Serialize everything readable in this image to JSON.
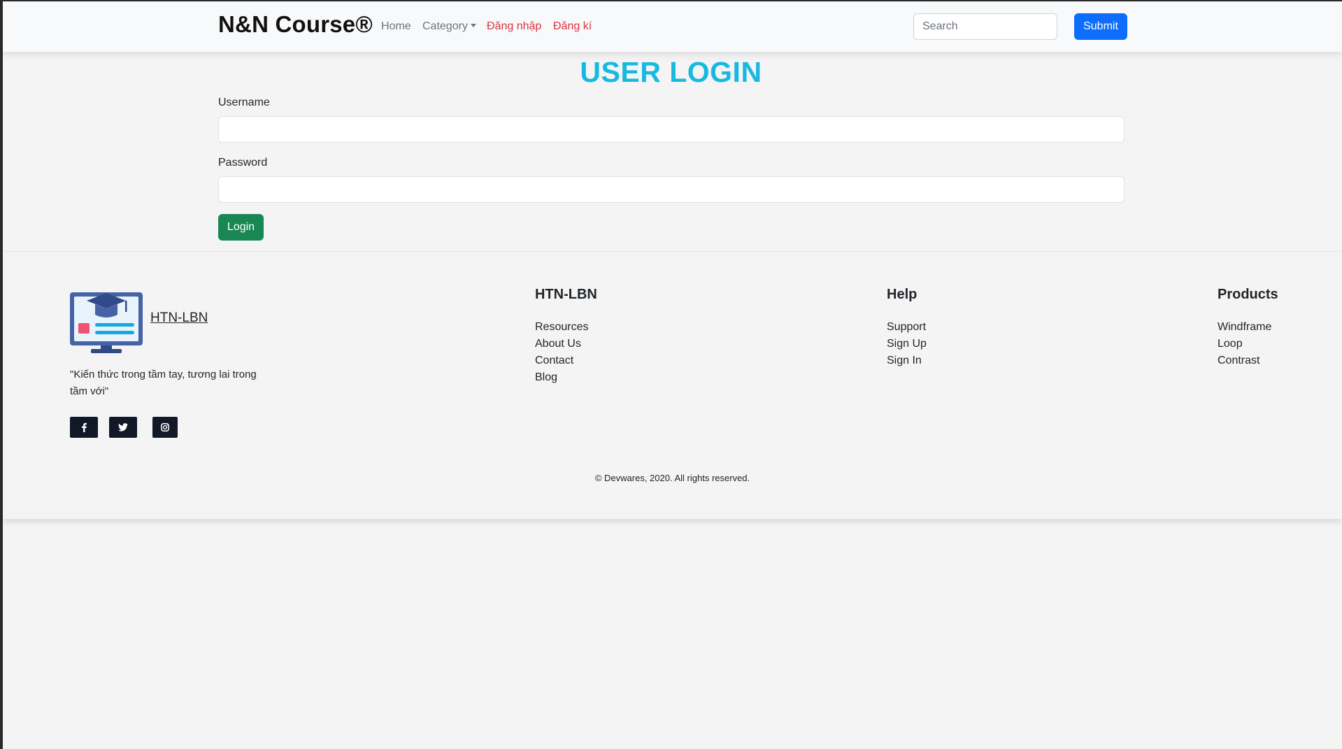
{
  "navbar": {
    "brand": "N&N Course®",
    "links": [
      {
        "label": "Home"
      },
      {
        "label": "Category"
      },
      {
        "label": "Đăng nhập"
      },
      {
        "label": "Đăng kí"
      }
    ],
    "search_placeholder": "Search",
    "submit_label": "Submit"
  },
  "login": {
    "title": "USER LOGIN",
    "username_label": "Username",
    "password_label": "Password",
    "username_value": "",
    "password_value": "",
    "login_label": "Login"
  },
  "footer": {
    "brand_name": "HTN-LBN",
    "tagline": "\"Kiến thức trong tầm tay, tương lai trong tầm với\"",
    "social": [
      {
        "icon": "facebook-icon"
      },
      {
        "icon": "twitter-icon"
      },
      {
        "icon": "instagram-icon"
      }
    ],
    "columns": [
      {
        "title": "HTN-LBN",
        "items": [
          "Resources",
          "About Us",
          "Contact",
          "Blog"
        ]
      },
      {
        "title": "Help",
        "items": [
          "Support",
          "Sign Up",
          "Sign In"
        ]
      },
      {
        "title": "Products",
        "items": [
          "Windframe",
          "Loop",
          "Contrast"
        ]
      }
    ],
    "copyright": "© Devwares, 2020. All rights reserved."
  },
  "colors": {
    "title_accent": "#17b9e1",
    "primary": "#0d6efd",
    "success": "#198754",
    "danger": "#dc3545"
  }
}
